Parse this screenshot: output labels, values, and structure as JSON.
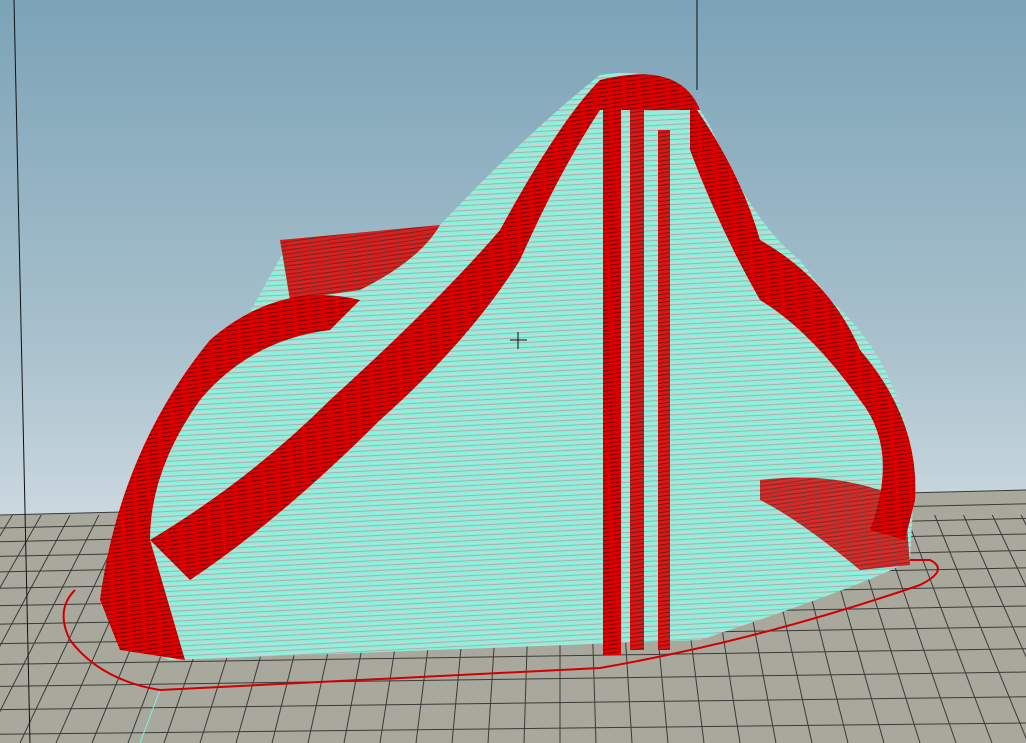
{
  "viewport": {
    "background_top": "#7ba3b7",
    "background_bottom": "#dfe6eb",
    "bed_color": "#a9a89c",
    "grid_color": "#3a3a3a",
    "perimeter_color": "#e00000",
    "infill_color": "#7ff5dc",
    "travel_color": "#d8d8e8",
    "skirt_color": "#d00000"
  }
}
